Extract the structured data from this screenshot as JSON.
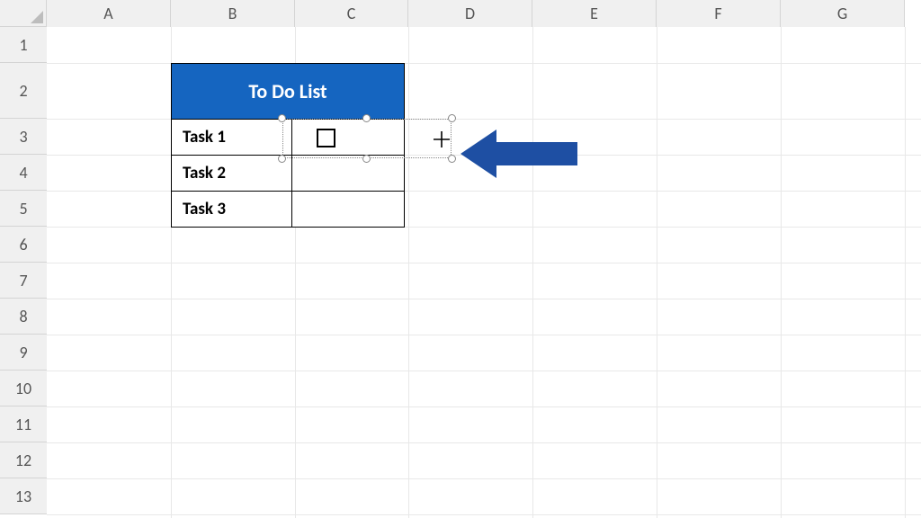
{
  "columns": [
    "A",
    "B",
    "C",
    "D",
    "E",
    "F",
    "G"
  ],
  "rows": [
    "1",
    "2",
    "3",
    "4",
    "5",
    "6",
    "7",
    "8",
    "9",
    "10",
    "11",
    "12",
    "13"
  ],
  "todo": {
    "title": "To Do List",
    "tasks": [
      {
        "label": "Task 1"
      },
      {
        "label": "Task 2"
      },
      {
        "label": "Task 3"
      }
    ],
    "header_bg": "#1565c0"
  },
  "arrow_color": "#1e4fa3"
}
